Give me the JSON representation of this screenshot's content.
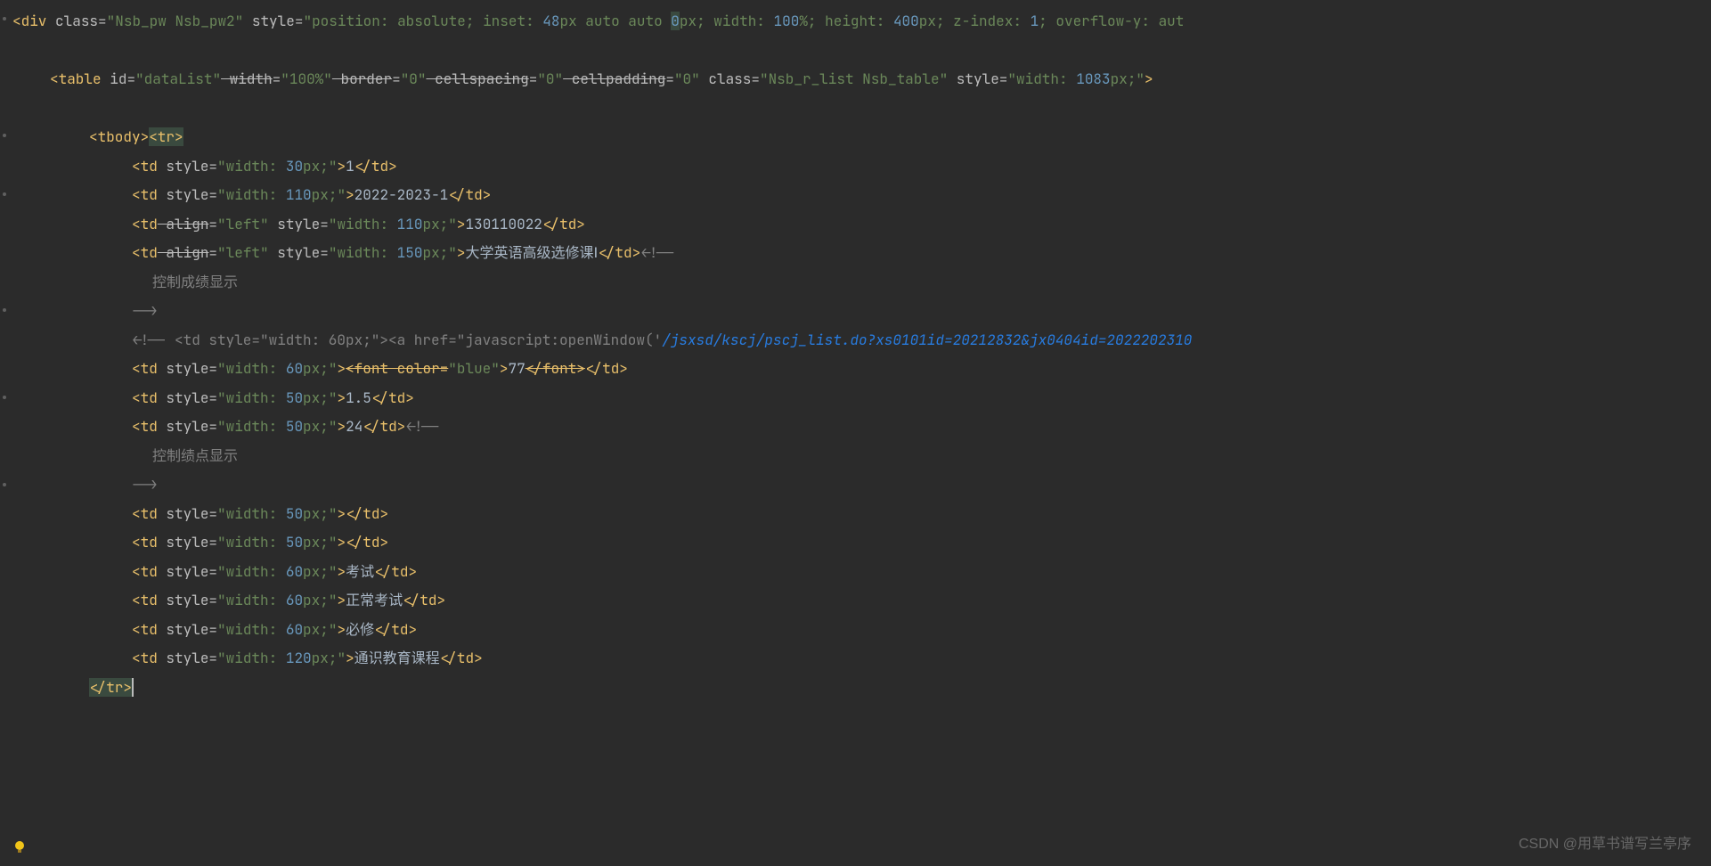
{
  "watermark": "CSDN @用草书谱写兰亭序",
  "code": {
    "l1": {
      "preDiv": "<",
      "divTag": "div",
      "classAttr": " class",
      "eq": "=",
      "classVal": "\"Nsb_pw Nsb_pw2\"",
      "styleAttr": " style",
      "styleVal1": "\"position: absolute; inset: ",
      "num48": "48",
      "pxAuto": "px auto auto ",
      "num0": "0",
      "pxSemi": "px",
      "semiW": "; width: ",
      "num100": "100",
      "pctH": "%; height: ",
      "num400": "400",
      "pxZ": "px; z-index: ",
      "num1": "1",
      "semiOverflow": "; overflow-y: aut"
    },
    "l2": {
      "pre": "<",
      "tableTag": "table",
      "idAttr": " id",
      "eq": "=",
      "idVal": "\"dataList\"",
      "widthAttr": " width",
      "widthVal": "\"100%\"",
      "borderAttr": " border",
      "borderVal": "\"0\"",
      "cellspAttr": " cellspacing",
      "cellspVal": "\"0\"",
      "cellpdAttr": " cellpadding",
      "cellpdVal": "\"0\"",
      "classAttr": " class",
      "classVal": "\"Nsb_r_list Nsb_table\"",
      "styleAttr": " style",
      "styleVal1": "\"width: ",
      "num1083": "1083",
      "styleVal2": "px;\"",
      "close": ">"
    },
    "l3": {
      "tbodyOpen": "<tbody>",
      "trOpen": "<tr>"
    },
    "tdStyle": "\"width: ",
    "pxEnd": "px;\"",
    "td": {
      "open": "<",
      "tag": "td",
      "styleAttr": " style",
      "eq": "=",
      "close": ">",
      "closeTag": "</td>",
      "alignAttr": " align",
      "alignVal": "\"left\""
    },
    "rows": {
      "r1_w": "30",
      "r1_v": "1",
      "r2_w": "110",
      "r2_v": "2022-2023-1",
      "r3_w": "110",
      "r3_v": "130110022",
      "r4_w": "150",
      "r4_v": "大学英语高级选修课Ⅰ",
      "r5_c": "<!--",
      "r6_v": "控制成绩显示",
      "r7_c": "-->",
      "r8_pre": "<!-- <td style=\"width: 60px;\"><a href=\"javascript:openWindow('",
      "r8_href": "/jsxsd/kscj/pscj_list.do?xs0101id=20212832&jx0404id=2022202310",
      "r9_w": "60",
      "r9_fontOpen": "<font color=",
      "r9_fontColor": "\"blue\"",
      "r9_fontClose": ">",
      "r9_v": "77",
      "r9_fontEnd": "</font>",
      "r10_w": "50",
      "r10_v": "1.5",
      "r11_w": "50",
      "r11_v": "24",
      "r12_v": "控制绩点显示",
      "r13_w": "50",
      "r14_w": "50",
      "r15_w": "60",
      "r15_v": "考试",
      "r16_w": "60",
      "r16_v": "正常考试",
      "r17_w": "60",
      "r17_v": "必修",
      "r18_w": "120",
      "r18_v": "通识教育课程",
      "trClose": "</tr>"
    }
  }
}
